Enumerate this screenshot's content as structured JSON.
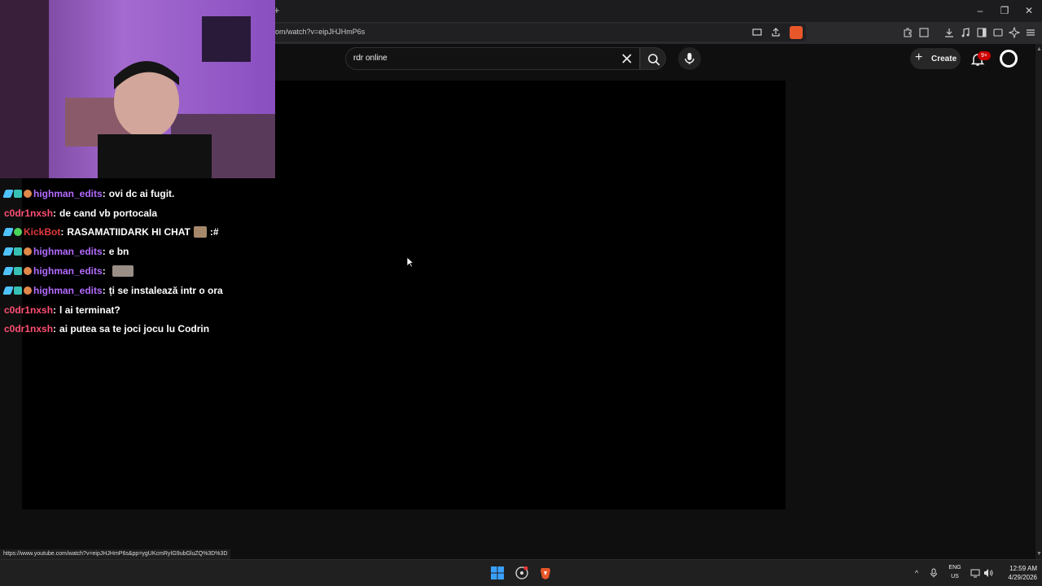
{
  "browser": {
    "new_tab_symbol": "+",
    "url_partial": "om/watch?v=eipJHJHmP6s",
    "status_url": "https://www.youtube.com/watch?v=eipJHJHmP6s&pp=ygUKcmRyIG9ubGluZQ%3D%3D",
    "window_controls": {
      "minimize": "–",
      "maximize": "❐",
      "close": "✕"
    },
    "accent": "#e8572a"
  },
  "youtube": {
    "search_value": "rdr online",
    "create_label": "Create",
    "create_plus": "+",
    "notifications_badge": "9+"
  },
  "chat": {
    "messages": [
      {
        "user": "highman_edits",
        "text": "ovi dc ai fugit."
      },
      {
        "user": "c0dr1nxsh",
        "text": "de cand vb portocala"
      },
      {
        "user": "KickBot",
        "text": "RASAMATIIDARK HI CHAT",
        "suffix": ":#"
      },
      {
        "user": "highman_edits",
        "text": "e bn"
      },
      {
        "user": "highman_edits",
        "text": ""
      },
      {
        "user": "highman_edits",
        "text": "ți se instalează intr o ora"
      },
      {
        "user": "c0dr1nxsh",
        "text": "l ai terminat?"
      },
      {
        "user": "c0dr1nxsh",
        "text": "ai putea sa te joci jocu lu Codrin"
      }
    ],
    "colors": {
      "purple": "#b36bff",
      "pink": "#ff4f73",
      "kickbot": "#e33b3b"
    }
  },
  "taskbar": {
    "lang_line1": "ENG",
    "lang_line2": "US",
    "time": "12:59 AM",
    "date": "4/29/2026"
  }
}
